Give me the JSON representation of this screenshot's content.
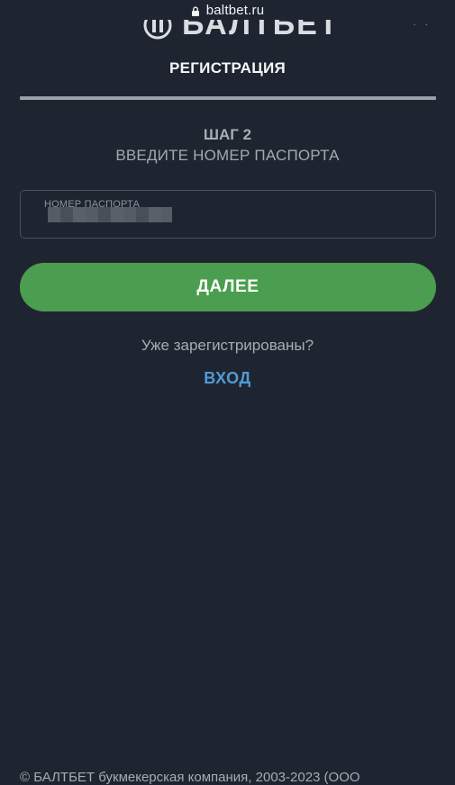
{
  "browser": {
    "url": "baltbet.ru"
  },
  "brand": {
    "logo_text": "БАЛТБЕТ"
  },
  "header": {
    "title": "РЕГИСТРАЦИЯ"
  },
  "step": {
    "number_label": "ШАГ 2",
    "instruction": "ВВЕДИТЕ НОМЕР ПАСПОРТА"
  },
  "form": {
    "passport_label": "НОМЕР ПАСПОРТА",
    "passport_value_state": "redacted",
    "next_button": "ДАЛЕЕ"
  },
  "login": {
    "prompt": "Уже зарегистрированы?",
    "link": "ВХОД"
  },
  "footer": {
    "copyright": "© БАЛТБЕТ букмекерская компания, 2003-2023 (ООО"
  },
  "colors": {
    "background": "#1f2530",
    "primary_button": "#4b9e4f",
    "link": "#4f9bd6",
    "divider": "#9aa0a8"
  },
  "icons": [
    "lock-icon",
    "baltbet-logo-icon"
  ]
}
